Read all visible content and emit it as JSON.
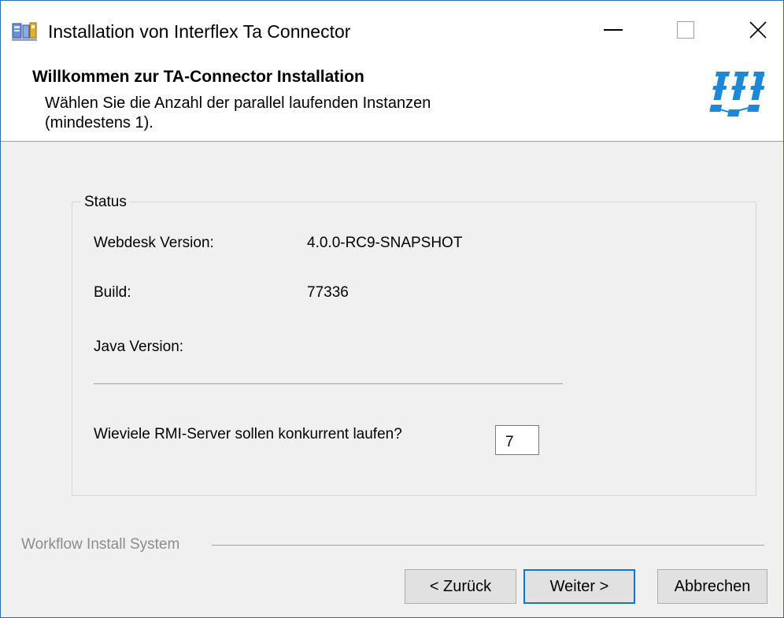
{
  "window": {
    "title": "Installation von Interflex Ta Connector",
    "controls": {
      "minimize": "—",
      "maximize": "☐",
      "close": "✕"
    },
    "app_icon": "installer-icon",
    "accent": "#2b6cb5"
  },
  "header": {
    "title": "Willkommen zur TA-Connector Installation",
    "description_line1": "Wählen Sie die Anzahl der parallel laufenden Instanzen",
    "description_line2": "(mindestens 1).",
    "logo": "network-logo-icon",
    "logo_color": "#1e88d8"
  },
  "status": {
    "legend": "Status",
    "rows": [
      {
        "label": "Webdesk Version:",
        "value": "4.0.0-RC9-SNAPSHOT"
      },
      {
        "label": "Build:",
        "value": "77336"
      },
      {
        "label": "Java Version:",
        "value": ""
      }
    ],
    "rmi_label": "Wieviele RMI-Server sollen konkurrent laufen?",
    "rmi_value": "7"
  },
  "footer": {
    "brand": "Workflow Install System",
    "buttons": {
      "back": "< Zurück",
      "next": "Weiter >",
      "cancel": "Abbrechen"
    },
    "focus_color": "#0078d7"
  }
}
